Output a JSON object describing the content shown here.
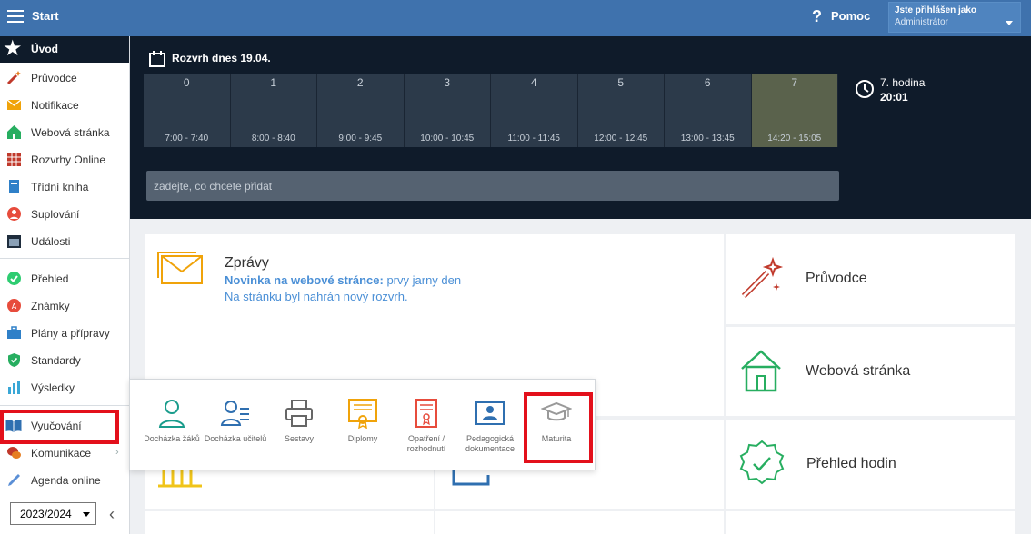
{
  "topbar": {
    "title": "Start",
    "help": "Pomoc",
    "user_line1": "Jste přihlášen jako",
    "user_line2": "Administrátor"
  },
  "sidebar": {
    "header": "Úvod",
    "items": [
      {
        "label": "Průvodce"
      },
      {
        "label": "Notifikace"
      },
      {
        "label": "Webová stránka"
      },
      {
        "label": "Rozvrhy Online"
      },
      {
        "label": "Třídní kniha"
      },
      {
        "label": "Suplování"
      },
      {
        "label": "Události"
      },
      {
        "label": "Přehled"
      },
      {
        "label": "Známky"
      },
      {
        "label": "Plány a přípravy"
      },
      {
        "label": "Standardy"
      },
      {
        "label": "Výsledky"
      },
      {
        "label": "Vyučování"
      },
      {
        "label": "Komunikace"
      },
      {
        "label": "Agenda online"
      }
    ],
    "year": "2023/2024"
  },
  "schedule": {
    "title": "Rozvrh dnes 19.04.",
    "periods": [
      {
        "num": "0",
        "time": "7:00 - 7:40"
      },
      {
        "num": "1",
        "time": "8:00 - 8:40"
      },
      {
        "num": "2",
        "time": "9:00 - 9:45"
      },
      {
        "num": "3",
        "time": "10:00 - 10:45"
      },
      {
        "num": "4",
        "time": "11:00 - 11:45"
      },
      {
        "num": "5",
        "time": "12:00 - 12:45"
      },
      {
        "num": "6",
        "time": "13:00 - 13:45"
      },
      {
        "num": "7",
        "time": "14:20 - 15:05"
      }
    ],
    "current_hour": "7. hodina",
    "current_time": "20:01",
    "add_placeholder": "zadejte, co chcete přidat"
  },
  "messages": {
    "title": "Zprávy",
    "line1_bold": "Novinka na webové stránce:",
    "line1_rest": " prvy jarny den",
    "line2": "Na stránku byl nahrán nový rozvrh."
  },
  "tiles": {
    "pruvodce": "Průvodce",
    "webova": "Webová stránka",
    "prehled": "Přehled hodin"
  },
  "popup": {
    "items": [
      {
        "label": "Docházka žáků"
      },
      {
        "label": "Docházka učitelů"
      },
      {
        "label": "Sestavy"
      },
      {
        "label": "Diplomy"
      },
      {
        "label": "Opatření / rozhodnutí"
      },
      {
        "label": "Pedagogická dokumentace"
      },
      {
        "label": "Maturita"
      }
    ]
  },
  "colors": {
    "topbar": "#3f72ad",
    "dark": "#0f1b2a",
    "highlight": "#e3101b",
    "link": "#4a8fd6"
  }
}
